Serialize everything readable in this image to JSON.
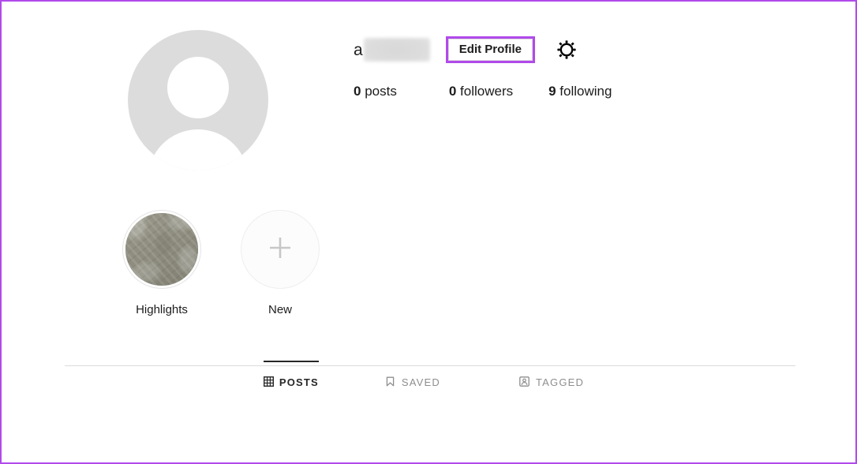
{
  "annotation": {
    "frame_color": "#b14aea",
    "highlight_color": "#b14aea"
  },
  "profile": {
    "avatar_icon": "default-avatar-icon",
    "username_visible": "a",
    "username_redacted": true,
    "edit_profile_label": "Edit Profile",
    "settings_icon": "gear-icon",
    "stats": [
      {
        "key": "posts",
        "value": "0",
        "label": " posts"
      },
      {
        "key": "followers",
        "value": "0",
        "label": " followers"
      },
      {
        "key": "following",
        "value": "9",
        "label": " following"
      }
    ]
  },
  "highlights": [
    {
      "label": "Highlights",
      "type": "story-highlight",
      "thumb": "damask-pattern"
    },
    {
      "label": "New",
      "type": "add-new",
      "icon": "plus-icon"
    }
  ],
  "tabs": [
    {
      "label": "POSTS",
      "icon": "grid-icon",
      "active": true
    },
    {
      "label": "SAVED",
      "icon": "bookmark-icon",
      "active": false
    },
    {
      "label": "TAGGED",
      "icon": "tagged-person-icon",
      "active": false
    }
  ]
}
